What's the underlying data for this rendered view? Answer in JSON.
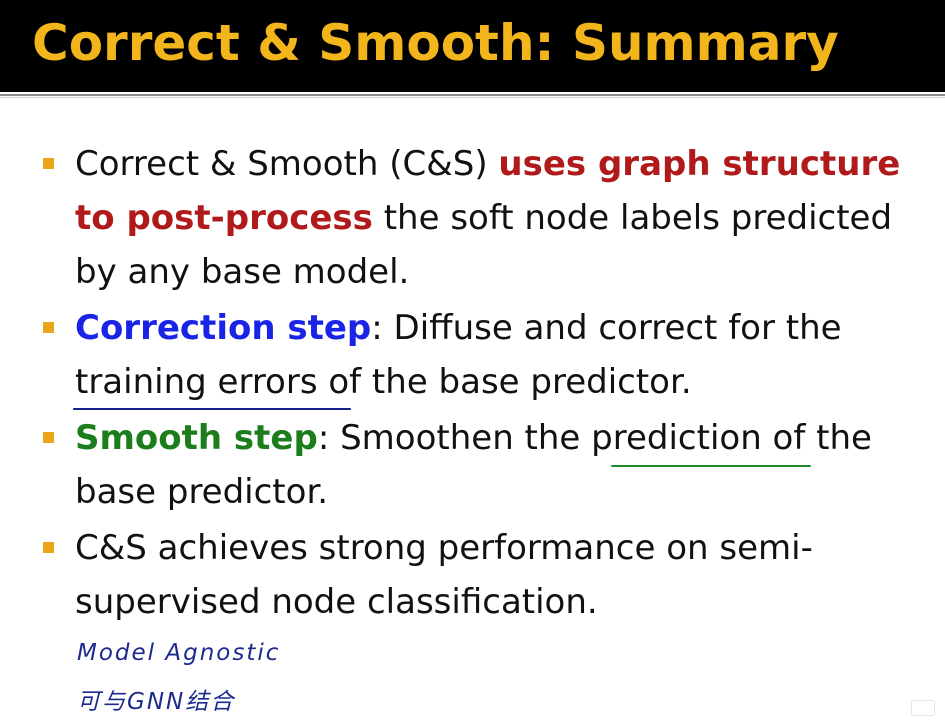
{
  "slide": {
    "title": "Correct & Smooth: Summary",
    "bullets": [
      {
        "parts": [
          {
            "text": "Correct & Smooth (C&S) ",
            "style": "normal"
          },
          {
            "text": "uses graph structure to post-process",
            "style": "emphasis-red"
          },
          {
            "text": " the soft node labels predicted by any base model.",
            "style": "normal"
          }
        ]
      },
      {
        "parts": [
          {
            "text": "Correction step",
            "style": "emphasis-blue"
          },
          {
            "text": ": Diffuse and correct for the training errors of the base predictor.",
            "style": "normal"
          }
        ]
      },
      {
        "parts": [
          {
            "text": "Smooth step",
            "style": "emphasis-green"
          },
          {
            "text": ": Smoothen the prediction of the base predictor.",
            "style": "normal"
          }
        ]
      },
      {
        "parts": [
          {
            "text": "C&S achieves strong performance on semi-supervised node classification.",
            "style": "normal"
          }
        ]
      }
    ]
  },
  "handwritten_notes": {
    "line1": "Model Agnostic",
    "line2": "可与GNN结合"
  },
  "colors": {
    "title_background": "#000000",
    "title_text": "#f3b51c",
    "bullet_marker": "#e9a61a",
    "emphasis_red": "#b01a1a",
    "emphasis_blue": "#1a24e6",
    "emphasis_green": "#1b7d1b",
    "ink_blue": "#15208a",
    "ink_green": "#1e8a2a"
  }
}
